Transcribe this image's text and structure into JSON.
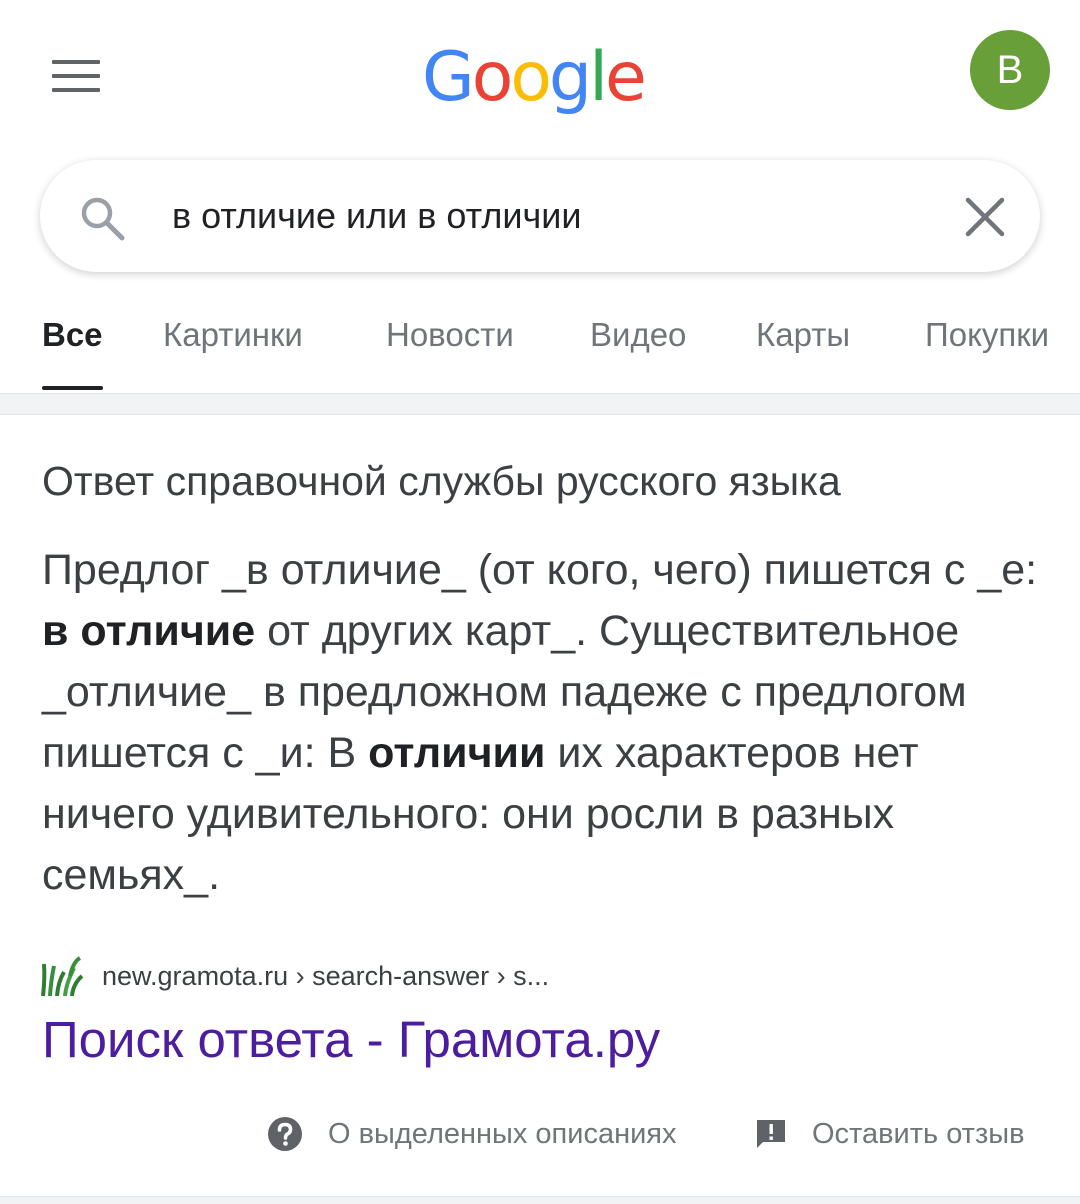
{
  "header": {
    "logo_letters": [
      {
        "char": "G",
        "color": "#4285F4"
      },
      {
        "char": "o",
        "color": "#EA4335"
      },
      {
        "char": "o",
        "color": "#FBBC05"
      },
      {
        "char": "g",
        "color": "#4285F4"
      },
      {
        "char": "l",
        "color": "#34A853"
      },
      {
        "char": "e",
        "color": "#EA4335"
      }
    ],
    "menu_icon": "hamburger-menu-icon",
    "avatar_letter": "В",
    "avatar_color": "#689F38"
  },
  "search": {
    "query": "в отличие или в отличии",
    "search_icon": "search-icon",
    "clear_icon": "close-icon"
  },
  "tabs": [
    {
      "label": "Все",
      "active": true
    },
    {
      "label": "Картинки",
      "active": false
    },
    {
      "label": "Новости",
      "active": false
    },
    {
      "label": "Видео",
      "active": false
    },
    {
      "label": "Карты",
      "active": false
    },
    {
      "label": "Покупки",
      "active": false
    }
  ],
  "snippet": {
    "title": "Ответ справочной службы русского языка",
    "answer_parts": [
      {
        "text": "Предлог _в отличие_ (от кого, чего) пишется с _е: ",
        "bold": false
      },
      {
        "text": "в отличие",
        "bold": true
      },
      {
        "text": " от других карт_. Существительное _отличие_ в предложном падеже с предлогом пишется с _и: В ",
        "bold": false
      },
      {
        "text": "отличии",
        "bold": true
      },
      {
        "text": " их характеров нет ничего удивительного: они росли в разных семьях_.",
        "bold": false
      }
    ],
    "source_url": "new.gramota.ru › search-answer › s...",
    "source_icon": "gramota-favicon-icon",
    "result_title": "Поиск ответа - Грамота.ру",
    "link_color": "#4C1D9E"
  },
  "footer": {
    "about_label": "О выделенных описаниях",
    "about_icon": "help-icon",
    "feedback_label": "Оставить отзыв",
    "feedback_icon": "feedback-icon"
  }
}
